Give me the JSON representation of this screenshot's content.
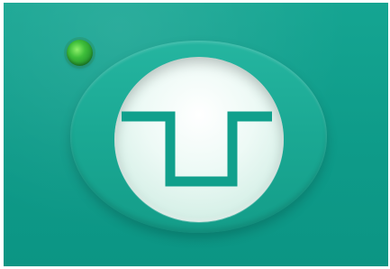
{
  "colors": {
    "panel": "#0e9b89",
    "bezel": "#1aa893",
    "dial": "#eefaf6",
    "symbol": "#10a08c",
    "led": "#3fbf3a"
  },
  "icons": {
    "indicator": "green-led-indicator-icon",
    "symbol": "square-pulse-waveform-icon"
  }
}
